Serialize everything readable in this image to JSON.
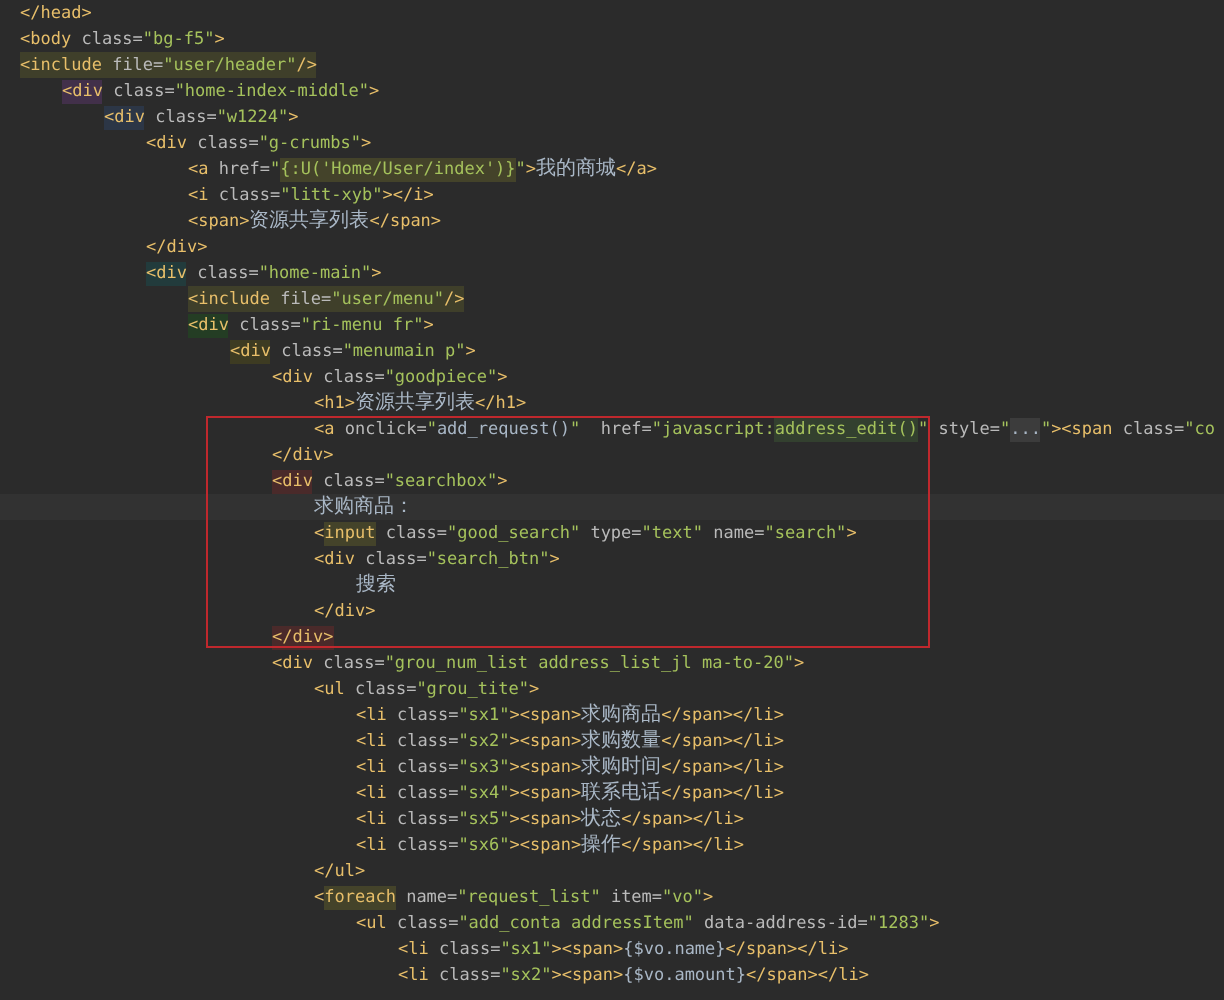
{
  "lines": [
    {
      "current": false,
      "tokens": [
        {
          "kind": "tag",
          "text": "</head>"
        }
      ]
    },
    {
      "current": false,
      "tokens": [
        {
          "kind": "tag",
          "text": "<body"
        },
        {
          "kind": "attr",
          "text": " class="
        },
        {
          "kind": "str",
          "text": "\"bg-f5\""
        },
        {
          "kind": "tag",
          "text": ">"
        }
      ]
    },
    {
      "current": false,
      "color": "#3f3f2a",
      "tokens": [
        {
          "kind": "tag",
          "text": "<include"
        },
        {
          "kind": "attr",
          "text": " file="
        },
        {
          "kind": "str",
          "text": "\"user/header\""
        },
        {
          "kind": "tag",
          "text": "/>"
        }
      ],
      "children": [
        {
          "current": false,
          "tokens": [
            {
              "kind": "tag",
              "text": "<div",
              "color": "#42304a"
            },
            {
              "kind": "attr",
              "text": " class="
            },
            {
              "kind": "str",
              "text": "\"home-index-middle\""
            },
            {
              "kind": "tag",
              "text": ">"
            }
          ],
          "children": [
            {
              "current": false,
              "tokens": [
                {
                  "kind": "tag",
                  "text": "<div",
                  "color": "#2c3646"
                },
                {
                  "kind": "attr",
                  "text": " class="
                },
                {
                  "kind": "str",
                  "text": "\"w1224\""
                },
                {
                  "kind": "tag",
                  "text": ">"
                }
              ],
              "children": [
                {
                  "current": false,
                  "tokens": [
                    {
                      "kind": "tag",
                      "text": "<div"
                    },
                    {
                      "kind": "attr",
                      "text": " class="
                    },
                    {
                      "kind": "str",
                      "text": "\"g-crumbs\""
                    },
                    {
                      "kind": "tag",
                      "text": ">"
                    }
                  ],
                  "children": [
                    {
                      "current": false,
                      "tokens": [
                        {
                          "kind": "tag",
                          "text": "<a"
                        },
                        {
                          "kind": "attr",
                          "text": " href="
                        },
                        {
                          "kind": "str",
                          "text": "\""
                        },
                        {
                          "kind": "str",
                          "text": "{:U('Home/User/index')}",
                          "color": "#44432a"
                        },
                        {
                          "kind": "str",
                          "text": "\""
                        },
                        {
                          "kind": "tag",
                          "text": ">"
                        },
                        {
                          "kind": "cjk",
                          "text": "我的商城"
                        },
                        {
                          "kind": "tag",
                          "text": "</a>"
                        }
                      ]
                    },
                    {
                      "current": false,
                      "tokens": [
                        {
                          "kind": "tag",
                          "text": "<i"
                        },
                        {
                          "kind": "attr",
                          "text": " class="
                        },
                        {
                          "kind": "str",
                          "text": "\"litt-xyb\""
                        },
                        {
                          "kind": "tag",
                          "text": "></i>"
                        }
                      ]
                    },
                    {
                      "current": false,
                      "tokens": [
                        {
                          "kind": "tag",
                          "text": "<span>"
                        },
                        {
                          "kind": "cjk",
                          "text": "资源共享列表"
                        },
                        {
                          "kind": "tag",
                          "text": "</span>"
                        }
                      ]
                    }
                  ]
                },
                {
                  "current": false,
                  "tokens": [
                    {
                      "kind": "tag",
                      "text": "</div>"
                    }
                  ]
                },
                {
                  "current": false,
                  "tokens": [
                    {
                      "kind": "tag",
                      "text": "<div",
                      "color": "#223b3c"
                    },
                    {
                      "kind": "attr",
                      "text": " class="
                    },
                    {
                      "kind": "str",
                      "text": "\"home-main\""
                    },
                    {
                      "kind": "tag",
                      "text": ">"
                    }
                  ],
                  "children": [
                    {
                      "current": false,
                      "color": "#3f3f2a",
                      "tokens": [
                        {
                          "kind": "tag",
                          "text": "<include"
                        },
                        {
                          "kind": "attr",
                          "text": " file="
                        },
                        {
                          "kind": "str",
                          "text": "\"user/menu\""
                        },
                        {
                          "kind": "tag",
                          "text": "/>"
                        }
                      ]
                    },
                    {
                      "current": false,
                      "tokens": [
                        {
                          "kind": "tag",
                          "text": "<div",
                          "color": "#243d24"
                        },
                        {
                          "kind": "attr",
                          "text": " class="
                        },
                        {
                          "kind": "str",
                          "text": "\"ri-menu fr\""
                        },
                        {
                          "kind": "tag",
                          "text": ">"
                        }
                      ],
                      "children": [
                        {
                          "current": false,
                          "tokens": [
                            {
                              "kind": "tag",
                              "text": "<div",
                              "color": "#3d3b22"
                            },
                            {
                              "kind": "attr",
                              "text": " class="
                            },
                            {
                              "kind": "str",
                              "text": "\"menumain p\""
                            },
                            {
                              "kind": "tag",
                              "text": ">"
                            }
                          ],
                          "children": [
                            {
                              "current": false,
                              "tokens": [
                                {
                                  "kind": "tag",
                                  "text": "<div"
                                },
                                {
                                  "kind": "attr",
                                  "text": " class="
                                },
                                {
                                  "kind": "str",
                                  "text": "\"goodpiece\""
                                },
                                {
                                  "kind": "tag",
                                  "text": ">"
                                }
                              ],
                              "children": [
                                {
                                  "current": false,
                                  "tokens": [
                                    {
                                      "kind": "tag",
                                      "text": "<h1>"
                                    },
                                    {
                                      "kind": "cjk",
                                      "text": "资源共享列表"
                                    },
                                    {
                                      "kind": "tag",
                                      "text": "</h1>"
                                    }
                                  ]
                                },
                                {
                                  "current": false,
                                  "tokens": [
                                    {
                                      "kind": "tag",
                                      "text": "<a"
                                    },
                                    {
                                      "kind": "attr",
                                      "text": " onclick="
                                    },
                                    {
                                      "kind": "str",
                                      "text": "\""
                                    },
                                    {
                                      "kind": "text",
                                      "text": "add_request()"
                                    },
                                    {
                                      "kind": "str",
                                      "text": "\""
                                    },
                                    {
                                      "kind": "attr",
                                      "text": "  href="
                                    },
                                    {
                                      "kind": "str",
                                      "text": "\"javascript:"
                                    },
                                    {
                                      "kind": "str",
                                      "text": "address_edit()",
                                      "color": "#33402f"
                                    },
                                    {
                                      "kind": "str",
                                      "text": "\""
                                    },
                                    {
                                      "kind": "attr",
                                      "text": " style="
                                    },
                                    {
                                      "kind": "str",
                                      "text": "\""
                                    },
                                    {
                                      "kind": "text",
                                      "text": "...",
                                      "color": "#3c3c3c"
                                    },
                                    {
                                      "kind": "str",
                                      "text": "\""
                                    },
                                    {
                                      "kind": "tag",
                                      "text": "><span"
                                    },
                                    {
                                      "kind": "attr",
                                      "text": " class="
                                    },
                                    {
                                      "kind": "str",
                                      "text": "\"co"
                                    }
                                  ]
                                }
                              ]
                            },
                            {
                              "current": false,
                              "tokens": [
                                {
                                  "kind": "tag",
                                  "text": "</div>"
                                }
                              ]
                            },
                            {
                              "current": false,
                              "tokens": [
                                {
                                  "kind": "tag",
                                  "text": "<div",
                                  "color": "#4a2a2a"
                                },
                                {
                                  "kind": "attr",
                                  "text": " class="
                                },
                                {
                                  "kind": "str",
                                  "text": "\"searchbox\""
                                },
                                {
                                  "kind": "tag",
                                  "text": ">"
                                }
                              ],
                              "children": [
                                {
                                  "current": true,
                                  "tokens": [
                                    {
                                      "kind": "cjk",
                                      "text": "求购商品："
                                    }
                                  ]
                                },
                                {
                                  "current": false,
                                  "tokens": [
                                    {
                                      "kind": "tag",
                                      "text": "<"
                                    },
                                    {
                                      "kind": "tag",
                                      "text": "input",
                                      "color": "#44432a"
                                    },
                                    {
                                      "kind": "attr",
                                      "text": " class="
                                    },
                                    {
                                      "kind": "str",
                                      "text": "\"good_search\""
                                    },
                                    {
                                      "kind": "attr",
                                      "text": " type="
                                    },
                                    {
                                      "kind": "str",
                                      "text": "\"text\""
                                    },
                                    {
                                      "kind": "attr",
                                      "text": " name="
                                    },
                                    {
                                      "kind": "str",
                                      "text": "\"search\""
                                    },
                                    {
                                      "kind": "tag",
                                      "text": ">"
                                    }
                                  ]
                                },
                                {
                                  "current": false,
                                  "tokens": [
                                    {
                                      "kind": "tag",
                                      "text": "<div"
                                    },
                                    {
                                      "kind": "attr",
                                      "text": " class="
                                    },
                                    {
                                      "kind": "str",
                                      "text": "\"search_btn\""
                                    },
                                    {
                                      "kind": "tag",
                                      "text": ">"
                                    }
                                  ],
                                  "children": [
                                    {
                                      "current": false,
                                      "tokens": [
                                        {
                                          "kind": "cjk",
                                          "text": "搜索"
                                        }
                                      ]
                                    }
                                  ]
                                },
                                {
                                  "current": false,
                                  "tokens": [
                                    {
                                      "kind": "tag",
                                      "text": "</div>"
                                    }
                                  ]
                                }
                              ]
                            },
                            {
                              "current": false,
                              "tokens": [
                                {
                                  "kind": "tag",
                                  "text": "</div>",
                                  "color": "#4a2a2a"
                                }
                              ]
                            },
                            {
                              "current": false,
                              "tokens": [
                                {
                                  "kind": "tag",
                                  "text": "<div"
                                },
                                {
                                  "kind": "attr",
                                  "text": " class="
                                },
                                {
                                  "kind": "str",
                                  "text": "\"grou_num_list address_list_jl ma-to-20\""
                                },
                                {
                                  "kind": "tag",
                                  "text": ">"
                                }
                              ],
                              "children": [
                                {
                                  "current": false,
                                  "tokens": [
                                    {
                                      "kind": "tag",
                                      "text": "<ul"
                                    },
                                    {
                                      "kind": "attr",
                                      "text": " class="
                                    },
                                    {
                                      "kind": "str",
                                      "text": "\"grou_tite\""
                                    },
                                    {
                                      "kind": "tag",
                                      "text": ">"
                                    }
                                  ],
                                  "children": [
                                    {
                                      "current": false,
                                      "tokens": [
                                        {
                                          "kind": "tag",
                                          "text": "<li"
                                        },
                                        {
                                          "kind": "attr",
                                          "text": " class="
                                        },
                                        {
                                          "kind": "str",
                                          "text": "\"sx1\""
                                        },
                                        {
                                          "kind": "tag",
                                          "text": "><span>"
                                        },
                                        {
                                          "kind": "cjk",
                                          "text": "求购商品"
                                        },
                                        {
                                          "kind": "tag",
                                          "text": "</span></li>"
                                        }
                                      ]
                                    },
                                    {
                                      "current": false,
                                      "tokens": [
                                        {
                                          "kind": "tag",
                                          "text": "<li"
                                        },
                                        {
                                          "kind": "attr",
                                          "text": " class="
                                        },
                                        {
                                          "kind": "str",
                                          "text": "\"sx2\""
                                        },
                                        {
                                          "kind": "tag",
                                          "text": "><span>"
                                        },
                                        {
                                          "kind": "cjk",
                                          "text": "求购数量"
                                        },
                                        {
                                          "kind": "tag",
                                          "text": "</span></li>"
                                        }
                                      ]
                                    },
                                    {
                                      "current": false,
                                      "tokens": [
                                        {
                                          "kind": "tag",
                                          "text": "<li"
                                        },
                                        {
                                          "kind": "attr",
                                          "text": " class="
                                        },
                                        {
                                          "kind": "str",
                                          "text": "\"sx3\""
                                        },
                                        {
                                          "kind": "tag",
                                          "text": "><span>"
                                        },
                                        {
                                          "kind": "cjk",
                                          "text": "求购时间"
                                        },
                                        {
                                          "kind": "tag",
                                          "text": "</span></li>"
                                        }
                                      ]
                                    },
                                    {
                                      "current": false,
                                      "tokens": [
                                        {
                                          "kind": "tag",
                                          "text": "<li"
                                        },
                                        {
                                          "kind": "attr",
                                          "text": " class="
                                        },
                                        {
                                          "kind": "str",
                                          "text": "\"sx4\""
                                        },
                                        {
                                          "kind": "tag",
                                          "text": "><span>"
                                        },
                                        {
                                          "kind": "cjk",
                                          "text": "联系电话"
                                        },
                                        {
                                          "kind": "tag",
                                          "text": "</span></li>"
                                        }
                                      ]
                                    },
                                    {
                                      "current": false,
                                      "tokens": [
                                        {
                                          "kind": "tag",
                                          "text": "<li"
                                        },
                                        {
                                          "kind": "attr",
                                          "text": " class="
                                        },
                                        {
                                          "kind": "str",
                                          "text": "\"sx5\""
                                        },
                                        {
                                          "kind": "tag",
                                          "text": "><span>"
                                        },
                                        {
                                          "kind": "cjk",
                                          "text": "状态"
                                        },
                                        {
                                          "kind": "tag",
                                          "text": "</span></li>"
                                        }
                                      ]
                                    },
                                    {
                                      "current": false,
                                      "tokens": [
                                        {
                                          "kind": "tag",
                                          "text": "<li"
                                        },
                                        {
                                          "kind": "attr",
                                          "text": " class="
                                        },
                                        {
                                          "kind": "str",
                                          "text": "\"sx6\""
                                        },
                                        {
                                          "kind": "tag",
                                          "text": "><span>"
                                        },
                                        {
                                          "kind": "cjk",
                                          "text": "操作"
                                        },
                                        {
                                          "kind": "tag",
                                          "text": "</span></li>"
                                        }
                                      ]
                                    }
                                  ]
                                },
                                {
                                  "current": false,
                                  "tokens": [
                                    {
                                      "kind": "tag",
                                      "text": "</ul>"
                                    }
                                  ]
                                },
                                {
                                  "current": false,
                                  "tokens": [
                                    {
                                      "kind": "tag",
                                      "text": "<"
                                    },
                                    {
                                      "kind": "tag",
                                      "text": "foreach",
                                      "color": "#44432a"
                                    },
                                    {
                                      "kind": "attr",
                                      "text": " name="
                                    },
                                    {
                                      "kind": "str",
                                      "text": "\"request_list\""
                                    },
                                    {
                                      "kind": "attr",
                                      "text": " item="
                                    },
                                    {
                                      "kind": "str",
                                      "text": "\"vo\""
                                    },
                                    {
                                      "kind": "tag",
                                      "text": ">"
                                    }
                                  ],
                                  "children": [
                                    {
                                      "current": false,
                                      "tokens": [
                                        {
                                          "kind": "tag",
                                          "text": "<ul"
                                        },
                                        {
                                          "kind": "attr",
                                          "text": " class="
                                        },
                                        {
                                          "kind": "str",
                                          "text": "\"add_conta addressItem\""
                                        },
                                        {
                                          "kind": "attr",
                                          "text": " data-address-id="
                                        },
                                        {
                                          "kind": "str",
                                          "text": "\"1283\""
                                        },
                                        {
                                          "kind": "tag",
                                          "text": ">"
                                        }
                                      ],
                                      "children": [
                                        {
                                          "current": false,
                                          "tokens": [
                                            {
                                              "kind": "tag",
                                              "text": "<li"
                                            },
                                            {
                                              "kind": "attr",
                                              "text": " class="
                                            },
                                            {
                                              "kind": "str",
                                              "text": "\"sx1\""
                                            },
                                            {
                                              "kind": "tag",
                                              "text": "><span>"
                                            },
                                            {
                                              "kind": "text",
                                              "text": "{$vo.name}"
                                            },
                                            {
                                              "kind": "tag",
                                              "text": "</span></li>"
                                            }
                                          ]
                                        },
                                        {
                                          "current": false,
                                          "tokens": [
                                            {
                                              "kind": "tag",
                                              "text": "<li"
                                            },
                                            {
                                              "kind": "attr",
                                              "text": " class="
                                            },
                                            {
                                              "kind": "str",
                                              "text": "\"sx2\""
                                            },
                                            {
                                              "kind": "tag",
                                              "text": "><span>"
                                            },
                                            {
                                              "kind": "text",
                                              "text": "{$vo.amount}"
                                            },
                                            {
                                              "kind": "tag",
                                              "text": "</span></li>"
                                            }
                                          ]
                                        }
                                      ]
                                    }
                                  ]
                                }
                              ]
                            }
                          ]
                        }
                      ]
                    }
                  ]
                }
              ]
            }
          ]
        }
      ]
    }
  ]
}
